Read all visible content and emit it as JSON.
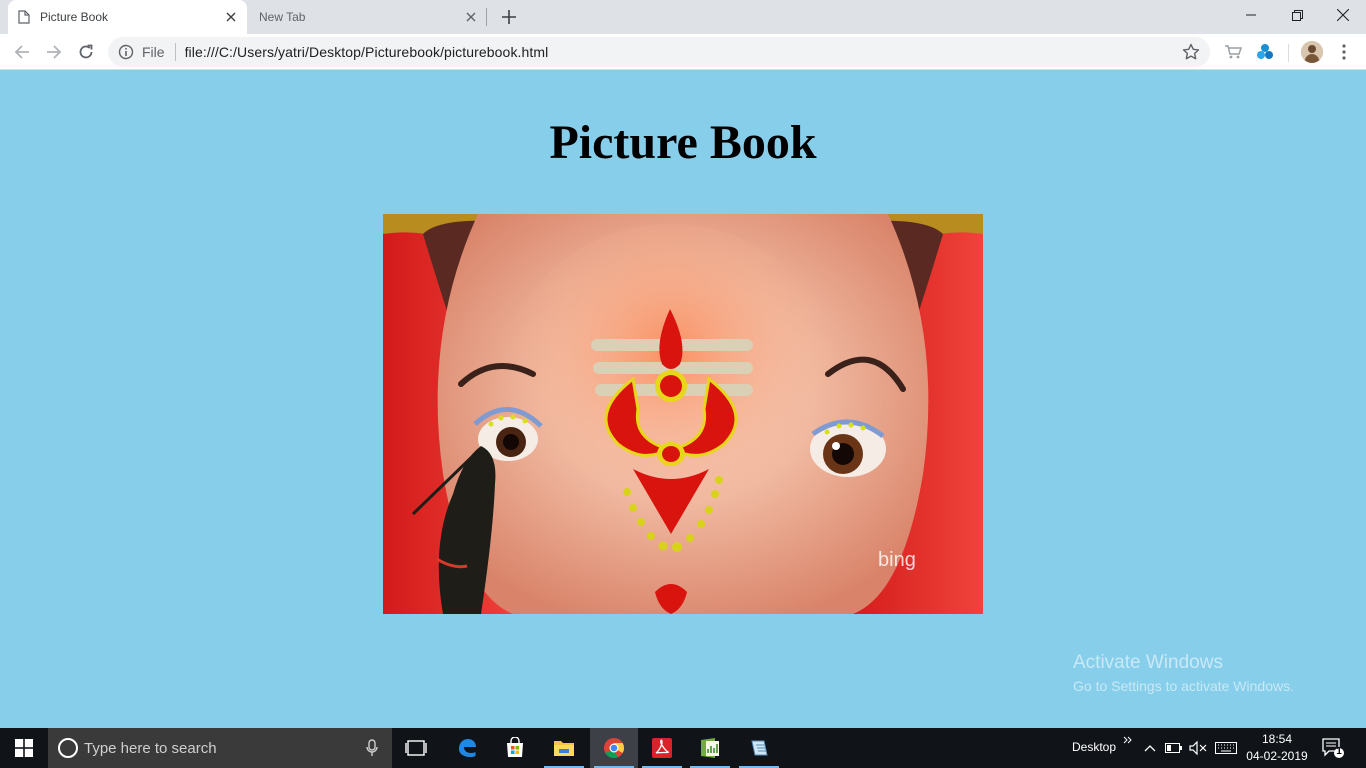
{
  "tabs": [
    {
      "title": "Picture Book",
      "active": true
    },
    {
      "title": "New Tab",
      "active": false
    }
  ],
  "omnibox": {
    "scheme_label": "File",
    "url": "file:///C:/Users/yatri/Desktop/Picturebook/picturebook.html"
  },
  "page": {
    "title": "Picture Book",
    "image_watermark": "bing"
  },
  "activation_notice": {
    "line1": "Activate Windows",
    "line2": "Go to Settings to activate Windows."
  },
  "taskbar": {
    "search_placeholder": "Type here to search",
    "apps": [
      "task-view",
      "edge",
      "store",
      "file-explorer",
      "chrome",
      "acrobat",
      "project-app",
      "notepad-app"
    ],
    "tray_label": "Desktop",
    "time": "18:54",
    "date": "04-02-2019",
    "notification_count": "1"
  },
  "colors": {
    "page_background": "#87CEEB",
    "tab_strip": "#dee1e6",
    "taskbar": "#101419"
  }
}
